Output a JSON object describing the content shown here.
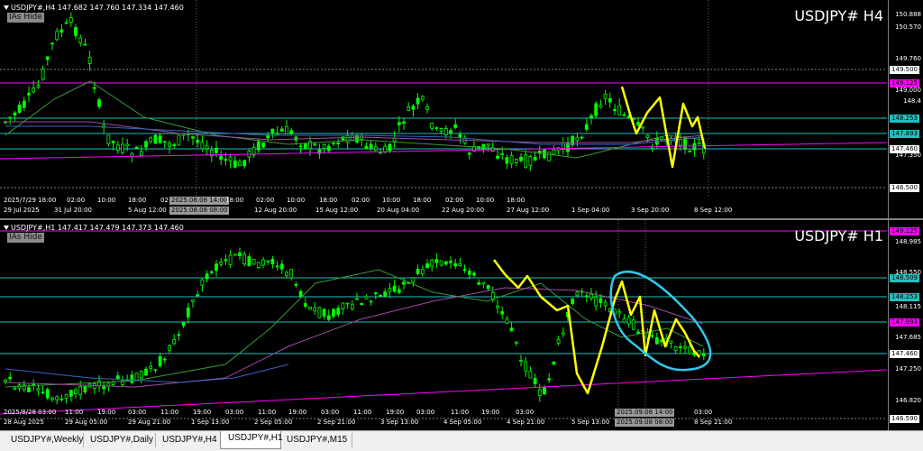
{
  "top": {
    "header": "USDJPY#,H4  147.682 147.760 147.334 147.460",
    "hide": "IAs Hide",
    "symbol": "USDJPY# H4",
    "prices": [
      "150.888",
      "150.570",
      "149.760",
      "149.500",
      "149.125",
      "149.000",
      "148.4",
      "148.253",
      "147.893",
      "147.460",
      "147.350",
      "146.500"
    ],
    "times": [
      "2025/7/29 18:00",
      "02:00",
      "10:00",
      "18:00",
      "02",
      "2025.08.08 14:00",
      "18:00",
      "02:00",
      "10:00",
      "18:00",
      "02:00",
      "10:00",
      "18:00",
      "02:00",
      "10:00",
      "18:00"
    ],
    "dates": [
      "29 Jul 2025",
      "31 Jul 20:00",
      "5 Aug 12:00",
      "2025.08.08 08:00",
      "12 Aug 20:00",
      "15 Aug 12:00",
      "20 Aug 04:00",
      "22 Aug 20:00",
      "27 Aug 12:00",
      "1 Sep 04:00",
      "3 Sep 20:00",
      "8 Sep 12:00"
    ]
  },
  "bottom": {
    "header": "USDJPY#,H1  147.417 147.479 147.373 147.460",
    "hide": "IAs Hide",
    "symbol": "USDJPY# H1",
    "prices": [
      "149.125",
      "148.985",
      "148.550",
      "148.509",
      "148.253",
      "148.115",
      "147.893",
      "147.685",
      "147.460",
      "147.250",
      "146.820",
      "146.590"
    ],
    "times": [
      "2025/8/28 03:00",
      "11:00",
      "19:00",
      "03:00",
      "11:00",
      "19:00",
      "03:00",
      "11:00",
      "19:00",
      "03:00",
      "11:00",
      "19:00",
      "03:00",
      "11:00",
      "19:00",
      "03:00",
      "2025.09.08 14:00",
      "03:00"
    ],
    "dates": [
      "28 Aug 2025",
      "29 Aug 05:00",
      "29 Aug 21:00",
      "1 Sep 13:00",
      "2 Sep 05:00",
      "2 Sep 21:00",
      "3 Sep 13:00",
      "4 Sep 05:00",
      "4 Sep 21:00",
      "5 Sep 13:00",
      "2025.09.08 08:00",
      "8 Sep 21:00"
    ]
  },
  "tabs": [
    "USDJPY#,Weekly",
    "USDJPY#,Daily",
    "USDJPY#,H4",
    "USDJPY#,H1",
    "USDJPY#,M15"
  ],
  "active_tab": "USDJPY#,H1",
  "colors": {
    "candle": "#00ff00",
    "magenta": "#ff00ff",
    "cyan": "#20c0c0",
    "yellow": "#ffff00",
    "circle": "#30c8e8"
  }
}
